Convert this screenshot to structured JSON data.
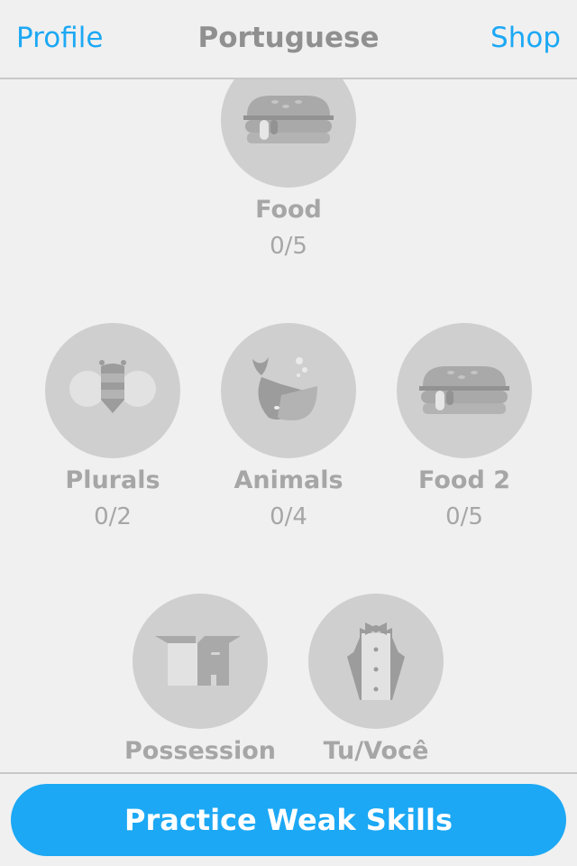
{
  "header": {
    "left": "Profile",
    "title": "Portuguese",
    "right": "Shop"
  },
  "skills": [
    {
      "name": "Food",
      "count": "0/5",
      "icon": "burger-icon"
    },
    {
      "name": "Plurals",
      "count": "0/2",
      "icon": "bee-icon"
    },
    {
      "name": "Animals",
      "count": "0/4",
      "icon": "whale-icon"
    },
    {
      "name": "Food 2",
      "count": "0/5",
      "icon": "burger-icon"
    },
    {
      "name": "Possession",
      "count": "",
      "icon": "box-icon"
    },
    {
      "name": "Tu/Você",
      "count": "",
      "icon": "tuxedo-icon"
    }
  ],
  "footer": {
    "button": "Practice Weak Skills"
  },
  "colors": {
    "accent": "#1ca8f4",
    "locked": "#cfcfcf"
  }
}
